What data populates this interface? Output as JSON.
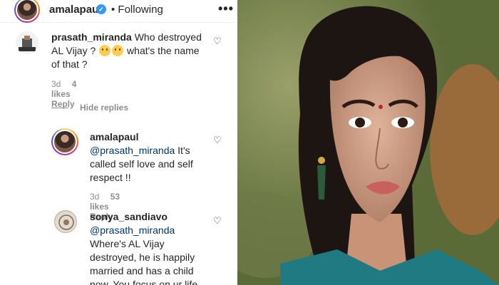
{
  "header": {
    "username": "amalapaul",
    "verified_icon": "verified-badge-icon",
    "follow_status": "• Following",
    "more_icon": "more-options-icon"
  },
  "comments": [
    {
      "username": "prasath_miranda",
      "text_a": "Who destroyed",
      "text_b": "AL Vijay ?",
      "text_c": "what's the name",
      "text_d": "of that ?",
      "date": "3d",
      "likes": "4 likes",
      "reply": "Reply"
    }
  ],
  "hide_replies": "Hide replies",
  "replies": [
    {
      "username": "amalapaul",
      "mention": "@prasath_miranda",
      "text_a": "It's",
      "text_b": "called self love and self",
      "text_c": "respect !!",
      "date": "3d",
      "likes": "53 likes",
      "reply": "Reply"
    },
    {
      "username": "sonya_sandiavo",
      "mention": "@prasath_miranda",
      "text_a": "Where's AL Vijay",
      "text_b": "destroyed, he is happily",
      "text_c": "married and has a child",
      "text_d": "now. You focus on ur life"
    }
  ],
  "colors": {
    "mention": "#00376b",
    "meta": "#8e8e8e",
    "verified": "#3897f0"
  }
}
